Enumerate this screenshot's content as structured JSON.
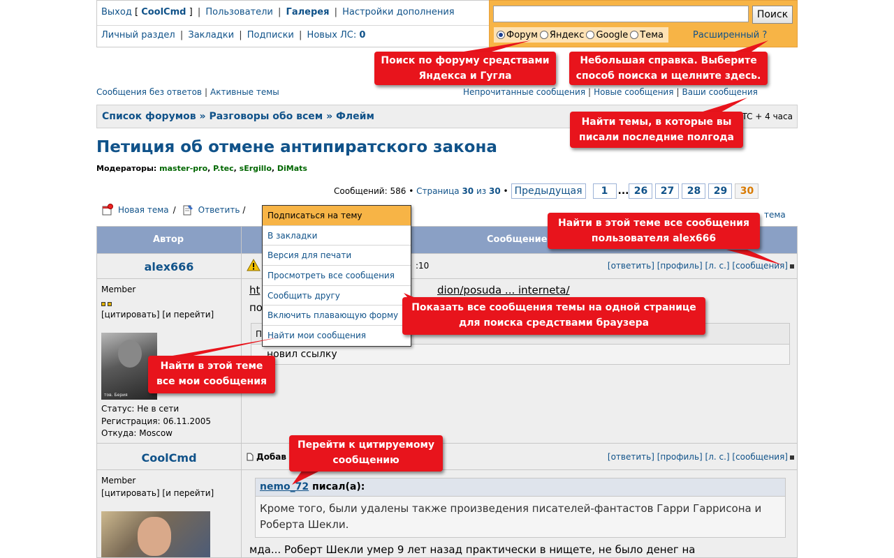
{
  "header": {
    "logout": "Выход",
    "username": "CoolCmd",
    "users": "Пользователи",
    "gallery": "Галерея",
    "addon_settings": "Настройки дополнения",
    "personal": "Личный раздел",
    "bookmarks": "Закладки",
    "subscriptions": "Подписки",
    "new_pm_label": "Новых ЛС:",
    "new_pm_count": "0"
  },
  "search": {
    "value": "",
    "button": "Поиск",
    "options": [
      "Форум",
      "Яндекс",
      "Google",
      "Тема"
    ],
    "selected": "Форум",
    "advanced": "Расширенный ?"
  },
  "callouts": {
    "yandex_google": "Поиск по форуму средствами\nЯндекса и Гугла",
    "help": "Небольшая справка. Выберите\nспособ поиска и щелните здесь.",
    "your_posts": "Найти темы, в которые вы\nписали последние полгода",
    "user_posts": "Найти в этой теме все сообщения\nпользователя alex666",
    "all_posts": "Показать все сообщения темы на одной странице\nдля поиска средствами браузера",
    "my_posts": "Найти в этой теме\nвсе мои сообщения",
    "quote_jump": "Перейти к цитируемому\nсообщению"
  },
  "sublinks": {
    "unanswered": "Сообщения без ответов",
    "active": "Активные темы",
    "unread": "Непрочитанные сообщения",
    "new": "Новые сообщения",
    "yours": "Ваши сообщения"
  },
  "breadcrumbs": {
    "forums": "Список форумов",
    "section": "Разговоры обо всем",
    "forum": "Флейм",
    "sep": "»",
    "timezone": "UTC + 4 часа"
  },
  "topic": {
    "title": "Петиция об отмене антипиратского закона",
    "moderators_label": "Модераторы:",
    "moderators": [
      "master-pro",
      "P.tec",
      "sErgillo",
      "DiMats"
    ]
  },
  "pagination": {
    "messages_label": "Сообщений:",
    "messages_count": "586",
    "page_label": "Страница",
    "current": "30",
    "of": "из",
    "total": "30",
    "prev": "Предыдущая",
    "pages": [
      "1",
      "...",
      "26",
      "27",
      "28",
      "29",
      "30"
    ]
  },
  "actions": {
    "new_topic": "Новая тема",
    "reply": "Ответить",
    "track_right": "тема"
  },
  "menu": {
    "items": [
      "Подписаться на тему",
      "В закладки",
      "Версия для печати",
      "Просмотреть все сообщения",
      "Сообщить другу",
      "Включить плавающую форму",
      "Найти мои сообщения"
    ]
  },
  "table": {
    "col_author": "Автор",
    "col_message": "Сообщение"
  },
  "post1": {
    "author": "alex666",
    "rank": "Member",
    "quote_links": "[цитировать] [и перейти]",
    "status": "Статус: Не в сети",
    "registered": "Регистрация: 06.11.2005",
    "from": "Откуда: Moscow",
    "time_frag": ":10",
    "tools": "[ответить] [профиль] [л. с.] [сообщения]",
    "link_start": "ht",
    "link_end": "dion/posuda ... interneta/",
    "text_frag": "по",
    "edit_frag": "П",
    "edited": "новил ссылку",
    "avatar_caption": "тов. Берия"
  },
  "post2": {
    "author": "CoolCmd",
    "rank": "Member",
    "quote_links": "[цитировать] [и перейти]",
    "added": "Добав",
    "tools": "[ответить] [профиль] [л. с.] [сообщения]",
    "quote_author": "nemo_72",
    "quote_wrote": "писал(а):",
    "quote_text": "Кроме того, были удалены также произведения писателей-фантастов Гарри Гаррисона и Роберта Шекли.",
    "reply": "мда... Роберт Шекли умер 9 лет назад практически в нищете, не было денег на"
  },
  "colors": {
    "accent": "#f7b446",
    "link": "#105289",
    "callout": "#e8141c",
    "table_head": "#8aa0c5"
  }
}
